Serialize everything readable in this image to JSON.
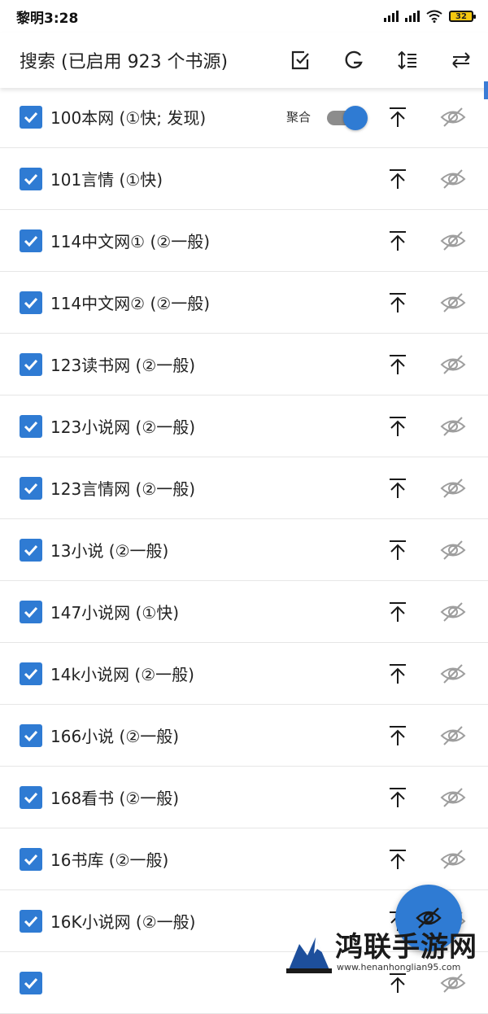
{
  "status": {
    "time": "黎明3:28",
    "battery": "32"
  },
  "header": {
    "title": "搜索 (已启用 923 个书源)"
  },
  "aggregate_label": "聚合",
  "sources": [
    {
      "name": "100本网 (①快; 发现)",
      "checked": true,
      "aggregate": true
    },
    {
      "name": "101言情 (①快)",
      "checked": true
    },
    {
      "name": "114中文网① (②一般)",
      "checked": true
    },
    {
      "name": "114中文网② (②一般)",
      "checked": true
    },
    {
      "name": "123读书网 (②一般)",
      "checked": true
    },
    {
      "name": "123小说网 (②一般)",
      "checked": true
    },
    {
      "name": "123言情网 (②一般)",
      "checked": true
    },
    {
      "name": "13小说 (②一般)",
      "checked": true
    },
    {
      "name": "147小说网 (①快)",
      "checked": true
    },
    {
      "name": "14k小说网 (②一般)",
      "checked": true
    },
    {
      "name": "166小说 (②一般)",
      "checked": true
    },
    {
      "name": "168看书 (②一般)",
      "checked": true
    },
    {
      "name": "16书库 (②一般)",
      "checked": true
    },
    {
      "name": "16K小说网 (②一般)",
      "checked": true
    },
    {
      "name": "",
      "checked": true
    }
  ],
  "icons": {
    "select": "checklist-icon",
    "group": "g-icon",
    "sort": "sort-icon",
    "swap": "swap-icon",
    "top": "move-to-top-icon",
    "hide": "eye-off-icon",
    "fab": "eye-off-icon"
  },
  "colors": {
    "accent": "#2f7bd3"
  },
  "watermark": {
    "title": "鸿联手游网",
    "url": "www.henanhonglian95.com"
  }
}
